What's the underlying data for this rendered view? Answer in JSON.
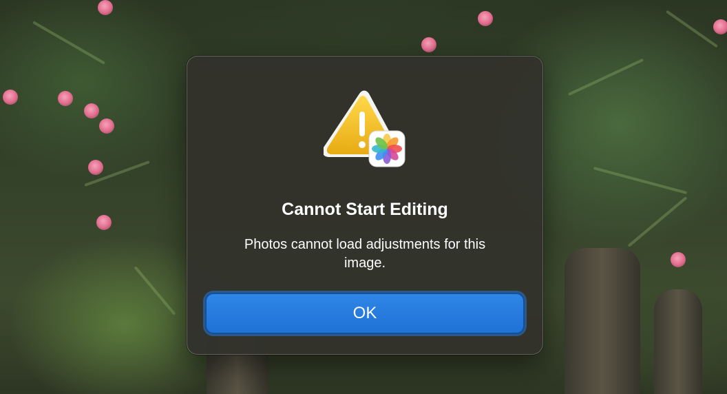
{
  "dialog": {
    "icon": "warning-triangle-with-photos-icon",
    "title": "Cannot Start Editing",
    "message": "Photos cannot load adjustments for this image.",
    "ok_label": "OK"
  },
  "colors": {
    "dialog_background": "#32322c",
    "button_blue": "#2479dd",
    "warning_yellow": "#f2c12e",
    "text": "#ffffff"
  }
}
